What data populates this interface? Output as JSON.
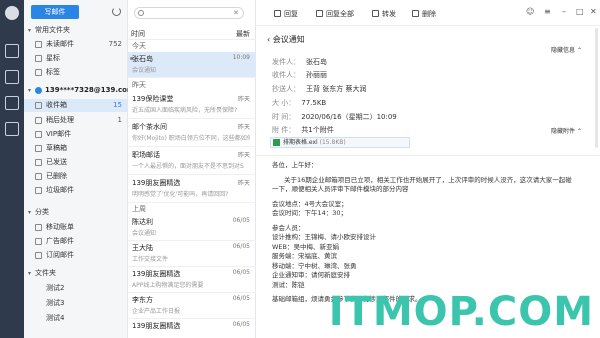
{
  "folders": {
    "write_label": "写邮件",
    "common_section": "常用文件夹",
    "common": [
      {
        "label": "未读邮件",
        "count": "752"
      },
      {
        "label": "星标",
        "count": ""
      },
      {
        "label": "标签",
        "count": ""
      }
    ],
    "account": "139****7328@139.com",
    "account_folders": [
      {
        "label": "收件箱",
        "count": "15"
      },
      {
        "label": "稍后处理",
        "count": "1"
      },
      {
        "label": "VIP邮件",
        "count": ""
      },
      {
        "label": "草稿箱",
        "count": ""
      },
      {
        "label": "已发送",
        "count": ""
      },
      {
        "label": "已删除",
        "count": ""
      },
      {
        "label": "垃圾邮件",
        "count": ""
      }
    ],
    "category_section": "分类",
    "categories": [
      {
        "label": "移动账单"
      },
      {
        "label": "广告邮件"
      },
      {
        "label": "订阅邮件"
      }
    ],
    "folder_section": "文件夹",
    "user_folders": [
      {
        "label": "测试2"
      },
      {
        "label": "测试3"
      },
      {
        "label": "测试4"
      }
    ]
  },
  "list": {
    "sort_label": "时间",
    "sort_order": "最新",
    "groups": {
      "today": "今天",
      "yesterday": "昨天",
      "earlier": "上周"
    },
    "items": [
      {
        "sender": "张石岛",
        "date": "10:09",
        "preview": "会议通知"
      },
      {
        "sender": "139保险课堂",
        "date": "昨天",
        "preview": "近五成国人面临疾病风险，无所畏保障?"
      },
      {
        "sender": "邮个茶水间",
        "date": "昨天",
        "preview": "你好(Mojito) 职场白领方位不同，这些都如何"
      },
      {
        "sender": "职场邮话",
        "date": "昨天",
        "preview": "一个人最忌惧的，面对朋友不是不思到对S"
      },
      {
        "sender": "139朋友圈精选",
        "date": "昨天",
        "preview": "明明感觉了'优化'可能吗，再请回回?"
      },
      {
        "sender": "陈达利",
        "date": "06/05",
        "preview": "会议通知"
      },
      {
        "sender": "王大陆",
        "date": "06/05",
        "preview": "工作交接文件"
      },
      {
        "sender": "139朋友圈精选",
        "date": "06/05",
        "preview": "APP线上购物满足您的需要"
      },
      {
        "sender": "李东方",
        "date": "06/05",
        "preview": "企业产品工作日报"
      },
      {
        "sender": "139朋友圈精选",
        "date": "06/05",
        "preview": ""
      }
    ]
  },
  "reader": {
    "toolbar": {
      "reply": "回复",
      "reply_all": "回复全部",
      "forward": "转发",
      "delete": "删除"
    },
    "subject": "会议通知",
    "hide_info": "隐藏信息",
    "hide_attachment": "隐藏附件",
    "from_label": "发件人：",
    "from": "张石岛",
    "to_label": "收件人：",
    "to": "孙丽丽",
    "cc_label": "抄送人：",
    "cc": "王背  张东方  蔡大润",
    "size_label": "大  小：",
    "size": "77.5KB",
    "time_label": "时  间：",
    "time": "2020/06/16（星期二）10:09",
    "attach_label": "附  件：",
    "attach_count": "共1个附件",
    "attach_name": "排期表格.exl",
    "attach_size": "(15.8KB)",
    "body": {
      "greeting": "各位，上午好：",
      "p1": "关于16期企业邮箱项目已立项，相关工作也开始展开了，上次评审的时候人没齐，这次请大家一起碰",
      "p2": "一下，顺便相关人员评审下邮件模块的部分内容",
      "loc": "会议地点：4号大会议室；",
      "time": "会议时间：下午14：30；",
      "people": "参会人员：",
      "r1": "设计推构：王锦梅、请小欧安排设计",
      "r2": "WEB：吴中梅、新亚娟",
      "r3": "服务端：宋福底、黄滨",
      "r4": "移动端：宁中树、琳湾、张勇",
      "r5": "企业通知审：请何新庭安排",
      "r6": "测试：陈铠",
      "closing": "基础邮箱组，烦请勇金参下会，有涉及邮件的需求。"
    }
  },
  "watermark": "ITMOP.COM",
  "colors": {
    "accent": "#2b85e4",
    "rail": "#2f3b4c",
    "selected": "#dbe9f9",
    "watermark": "#3bc5ad"
  }
}
